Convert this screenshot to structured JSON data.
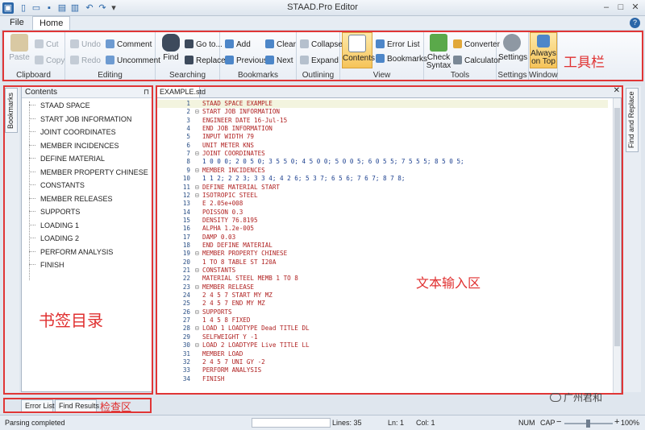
{
  "window": {
    "title": "STAAD.Pro Editor"
  },
  "quick_access": {
    "icons": [
      "app-icon",
      "new-icon",
      "open-icon",
      "save-icon",
      "print-icon",
      "print-preview-icon",
      "undo-icon",
      "redo-icon",
      "customize-icon"
    ]
  },
  "menu_tabs": {
    "file": "File",
    "home": "Home"
  },
  "ribbon": {
    "clipboard": {
      "label": "Clipboard",
      "paste": "Paste",
      "cut": "Cut",
      "copy": "Copy"
    },
    "editing": {
      "label": "Editing",
      "undo": "Undo",
      "redo": "Redo",
      "comment": "Comment",
      "uncomment": "Uncomment"
    },
    "searching": {
      "label": "Searching",
      "find": "Find",
      "goto": "Go to...",
      "replace": "Replace"
    },
    "bookmarks": {
      "label": "Bookmarks",
      "add": "Add",
      "clear": "Clear",
      "previous": "Previous",
      "next": "Next"
    },
    "outlining": {
      "label": "Outlining",
      "collapse": "Collapse",
      "expand": "Expand"
    },
    "view": {
      "label": "View",
      "contents": "Contents",
      "error_list": "Error List",
      "bookmarks": "Bookmarks"
    },
    "tools": {
      "label": "Tools",
      "check_syntax": "Check Syntax",
      "converter": "Converter",
      "calculator": "Calculator"
    },
    "settings": {
      "label": "Settings",
      "settings": "Settings"
    },
    "window": {
      "label": "Window",
      "always_on_top": "Always on Top"
    }
  },
  "annotations": {
    "toolbar": "工具栏",
    "bookmarks_dir": "书签目录",
    "text_area": "文本输入区",
    "check_area": "检查区"
  },
  "left_panel": {
    "side_tab": "Bookmarks",
    "title": "Contents",
    "items": [
      "STAAD SPACE",
      "START JOB INFORMATION",
      "JOINT COORDINATES",
      "MEMBER INCIDENCES",
      "DEFINE MATERIAL",
      "MEMBER PROPERTY CHINESE",
      "CONSTANTS",
      "MEMBER RELEASES",
      "SUPPORTS",
      "LOADING 1",
      "LOADING 2",
      "PERFORM ANALYSIS",
      "FINISH"
    ]
  },
  "editor": {
    "tab": "EXAMPLE.std",
    "lines": [
      {
        "n": "1",
        "fold": "",
        "text": "STAAD SPACE EXAMPLE",
        "color": "red"
      },
      {
        "n": "2",
        "fold": "⊟",
        "text": "START JOB INFORMATION",
        "color": "red"
      },
      {
        "n": "3",
        "fold": "",
        "text": "ENGINEER DATE 16-Jul-15",
        "color": "red"
      },
      {
        "n": "4",
        "fold": "",
        "text": "END JOB INFORMATION",
        "color": "red"
      },
      {
        "n": "5",
        "fold": "",
        "text": "INPUT WIDTH 79",
        "color": "red"
      },
      {
        "n": "6",
        "fold": "",
        "text": "UNIT METER KNS",
        "color": "red"
      },
      {
        "n": "7",
        "fold": "⊟",
        "text": "JOINT COORDINATES",
        "color": "red"
      },
      {
        "n": "8",
        "fold": "",
        "text": "1 0 0 0; 2 0 5 0; 3 5 5 0; 4 5 0 0; 5 0 0 5; 6 0 5 5; 7 5 5 5; 8 5 0 5;",
        "color": "blue"
      },
      {
        "n": "9",
        "fold": "⊟",
        "text": "MEMBER INCIDENCES",
        "color": "red"
      },
      {
        "n": "10",
        "fold": "",
        "text": "1 1 2; 2 2 3; 3 3 4; 4 2 6; 5 3 7; 6 5 6; 7 6 7; 8 7 8;",
        "color": "blue"
      },
      {
        "n": "11",
        "fold": "⊟",
        "text": "DEFINE MATERIAL START",
        "color": "red"
      },
      {
        "n": "12",
        "fold": "⊟",
        "text": "ISOTROPIC STEEL",
        "color": "red"
      },
      {
        "n": "13",
        "fold": "",
        "text": "E 2.05e+008",
        "color": "red"
      },
      {
        "n": "14",
        "fold": "",
        "text": "POISSON 0.3",
        "color": "red"
      },
      {
        "n": "15",
        "fold": "",
        "text": "DENSITY 76.8195",
        "color": "red"
      },
      {
        "n": "16",
        "fold": "",
        "text": "ALPHA 1.2e-005",
        "color": "red"
      },
      {
        "n": "17",
        "fold": "",
        "text": "DAMP 0.03",
        "color": "red"
      },
      {
        "n": "18",
        "fold": "",
        "text": "END DEFINE MATERIAL",
        "color": "red"
      },
      {
        "n": "19",
        "fold": "⊟",
        "text": "MEMBER PROPERTY CHINESE",
        "color": "red"
      },
      {
        "n": "20",
        "fold": "",
        "text": "1 TO 8 TABLE ST I20A",
        "color": "red"
      },
      {
        "n": "21",
        "fold": "⊟",
        "text": "CONSTANTS",
        "color": "red"
      },
      {
        "n": "22",
        "fold": "",
        "text": "MATERIAL STEEL MEMB 1 TO 8",
        "color": "red"
      },
      {
        "n": "23",
        "fold": "⊟",
        "text": "MEMBER RELEASE",
        "color": "red"
      },
      {
        "n": "24",
        "fold": "",
        "text": "2 4 5 7 START MY MZ",
        "color": "red"
      },
      {
        "n": "25",
        "fold": "",
        "text": "2 4 5 7 END MY MZ",
        "color": "red"
      },
      {
        "n": "26",
        "fold": "⊟",
        "text": "SUPPORTS",
        "color": "red"
      },
      {
        "n": "27",
        "fold": "",
        "text": "1 4 5 8 FIXED",
        "color": "red"
      },
      {
        "n": "28",
        "fold": "⊟",
        "text": "LOAD 1 LOADTYPE Dead TITLE DL",
        "color": "red"
      },
      {
        "n": "29",
        "fold": "",
        "text": "SELFWEIGHT Y -1",
        "color": "red"
      },
      {
        "n": "30",
        "fold": "⊟",
        "text": "LOAD 2 LOADTYPE Live TITLE LL",
        "color": "red"
      },
      {
        "n": "31",
        "fold": "",
        "text": "MEMBER LOAD",
        "color": "red"
      },
      {
        "n": "32",
        "fold": "",
        "text": "2 4 5 7 UNI GY -2",
        "color": "red"
      },
      {
        "n": "33",
        "fold": "",
        "text": "PERFORM ANALYSIS",
        "color": "red"
      },
      {
        "n": "34",
        "fold": "",
        "text": "FINISH",
        "color": "red"
      }
    ]
  },
  "right_panel": {
    "side_tab": "Find and Replace"
  },
  "bottom_tabs": {
    "error_list": "Error List",
    "find_results": "Find Results"
  },
  "status": {
    "message": "Parsing completed",
    "lines": "Lines: 35",
    "ln": "Ln: 1",
    "col": "Col: 1",
    "num": "NUM",
    "cap": "CAP",
    "zoom": "100%"
  },
  "watermark": "广州君和",
  "colors": {
    "annotation_red": "#e03636",
    "keyword_red": "#b02222",
    "code_blue": "#1b3f8f",
    "selected_orange": "#f6c45a"
  }
}
